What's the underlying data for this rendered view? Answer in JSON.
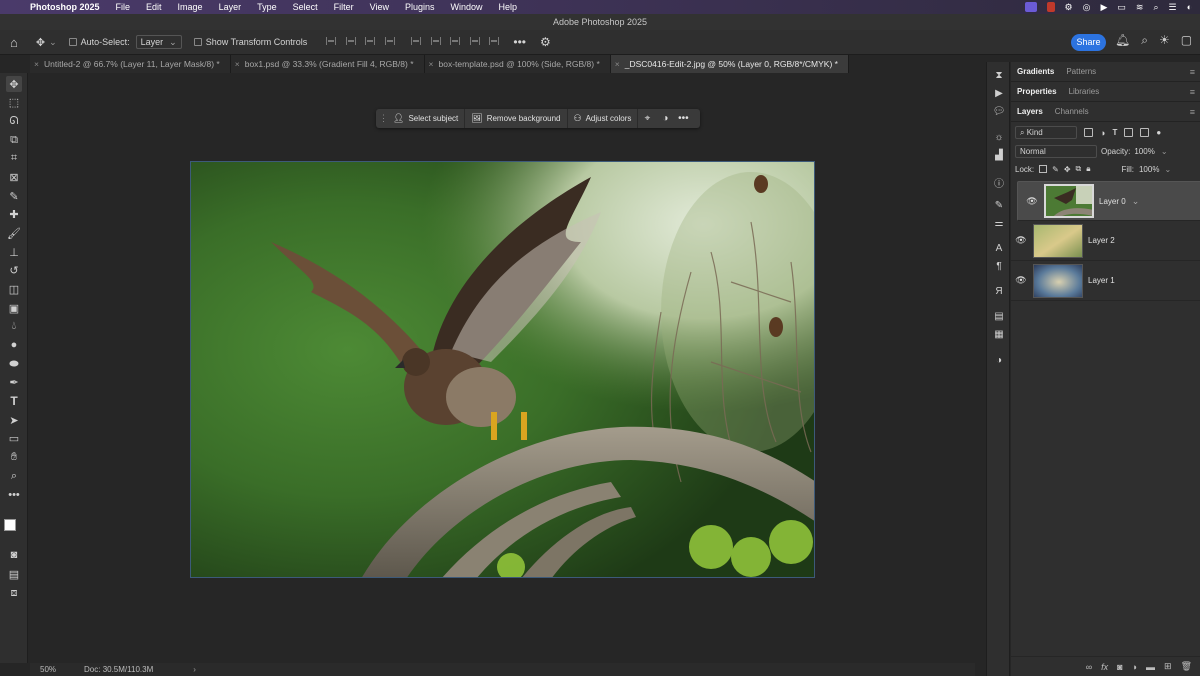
{
  "menubar": {
    "app": "Photoshop 2025",
    "items": [
      "File",
      "Edit",
      "Image",
      "Layer",
      "Type",
      "Select",
      "Filter",
      "View",
      "Plugins",
      "Window",
      "Help"
    ]
  },
  "window": {
    "title": "Adobe Photoshop 2025"
  },
  "options": {
    "auto_select_label": "Auto-Select:",
    "auto_select_value": "Layer",
    "transform_label": "Show Transform Controls",
    "share_label": "Share"
  },
  "tabs": [
    {
      "label": "Untitled-2 @ 66.7% (Layer 11, Layer Mask/8) *"
    },
    {
      "label": "box1.psd @ 33.3% (Gradient Fill 4, RGB/8) *"
    },
    {
      "label": "box-template.psd @ 100% (Side, RGB/8) *"
    },
    {
      "label": "_DSC0416-Edit-2.jpg @ 50% (Layer 0, RGB/8*/CMYK) *"
    }
  ],
  "contextbar": {
    "select_subject": "Select subject",
    "remove_background": "Remove background",
    "adjust_colors": "Adjust colors"
  },
  "status": {
    "zoom": "50%",
    "doc": "Doc: 30.5M/110.3M"
  },
  "panels": {
    "top_tabs": [
      "Gradients",
      "Patterns"
    ],
    "mid_tabs": [
      "Properties",
      "Libraries"
    ],
    "layer_tabs": [
      "Layers",
      "Channels"
    ],
    "kind_label": "Kind",
    "blend_mode": "Normal",
    "opacity_label": "Opacity:",
    "opacity_value": "100%",
    "lock_label": "Lock:",
    "fill_label": "Fill:",
    "fill_value": "100%",
    "layers": [
      {
        "name": "Layer 0",
        "selected": true
      },
      {
        "name": "Layer 2",
        "selected": false
      },
      {
        "name": "Layer 1",
        "selected": false
      }
    ]
  }
}
